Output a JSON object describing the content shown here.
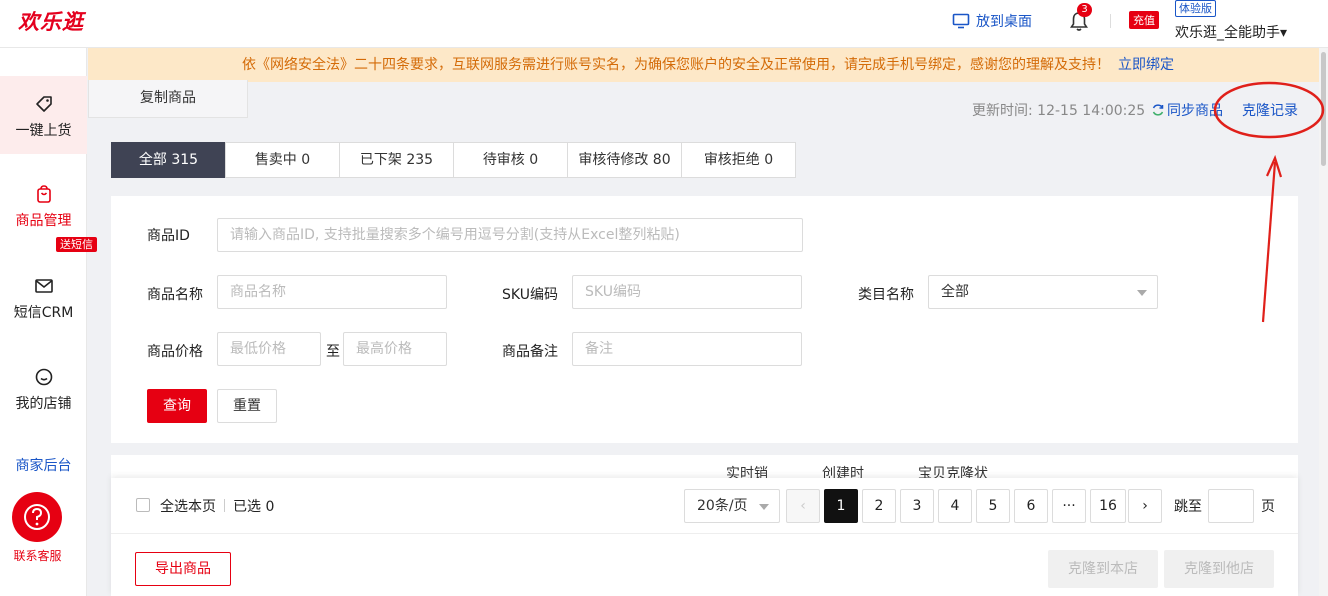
{
  "app": {
    "logo": "欢乐逛"
  },
  "header": {
    "desktop_label": "放到桌面",
    "notification_count": "3",
    "recharge_label": "充值",
    "trial_label": "体验版",
    "username": "欢乐逛_全能助手",
    "username_caret": "▾"
  },
  "sidebar": {
    "items": [
      {
        "label": "一键上货",
        "icon": "tag-icon"
      },
      {
        "label": "商品管理",
        "icon": "shopping-bag-icon"
      },
      {
        "label": "短信CRM",
        "icon": "mail-icon"
      },
      {
        "label": "我的店铺",
        "icon": "smile-icon"
      }
    ],
    "sms_badge": "送短信",
    "merchant_label": "商家后台",
    "help_label": "联系客服"
  },
  "notice": {
    "text": "依《网络安全法》二十四条要求，互联网服务需进行账号实名，为确保您账户的安全及正常使用，请完成手机号绑定，感谢您的理解及支持！",
    "link": "立即绑定"
  },
  "page_tab": "复制商品",
  "toolbar": {
    "update_time": "更新时间: 12-15 14:00:25",
    "sync_label": "同步商品",
    "clone_log_label": "克隆记录"
  },
  "status_tabs": [
    {
      "label": "全部 315",
      "active": true
    },
    {
      "label": "售卖中 0"
    },
    {
      "label": "已下架 235"
    },
    {
      "label": "待审核 0"
    },
    {
      "label": "审核待修改 80"
    },
    {
      "label": "审核拒绝 0"
    }
  ],
  "filters": {
    "product_id_label": "商品ID",
    "product_id_placeholder": "请输入商品ID, 支持批量搜索多个编号用逗号分割(支持从Excel整列粘贴)",
    "product_name_label": "商品名称",
    "product_name_placeholder": "商品名称",
    "sku_label": "SKU编码",
    "sku_placeholder": "SKU编码",
    "category_label": "类目名称",
    "category_value": "全部",
    "price_label": "商品价格",
    "min_price_placeholder": "最低价格",
    "to_label": "至",
    "max_price_placeholder": "最高价格",
    "remark_label": "商品备注",
    "remark_placeholder": "备注",
    "query_label": "查询",
    "reset_label": "重置"
  },
  "table": {
    "ghost_headers": [
      "实时销",
      "创建时",
      "宝贝克隆状"
    ]
  },
  "pagination": {
    "select_all_label": "全选本页",
    "selected_label": "已选 0",
    "page_size": "20条/页",
    "prev": "‹",
    "next": "›",
    "pages": [
      "1",
      "2",
      "3",
      "4",
      "5",
      "6",
      "···",
      "16"
    ],
    "active_page": "1",
    "jump_label": "跳至",
    "page_word": "页"
  },
  "actions": {
    "export_label": "导出商品",
    "clone_to_this_label": "克隆到本店",
    "clone_to_other_label": "克隆到他店"
  },
  "colors": {
    "brand_red": "#e60012",
    "link_blue": "#1a56c7",
    "notice_bg": "#fde8c8",
    "active_tab": "#3f4354"
  }
}
